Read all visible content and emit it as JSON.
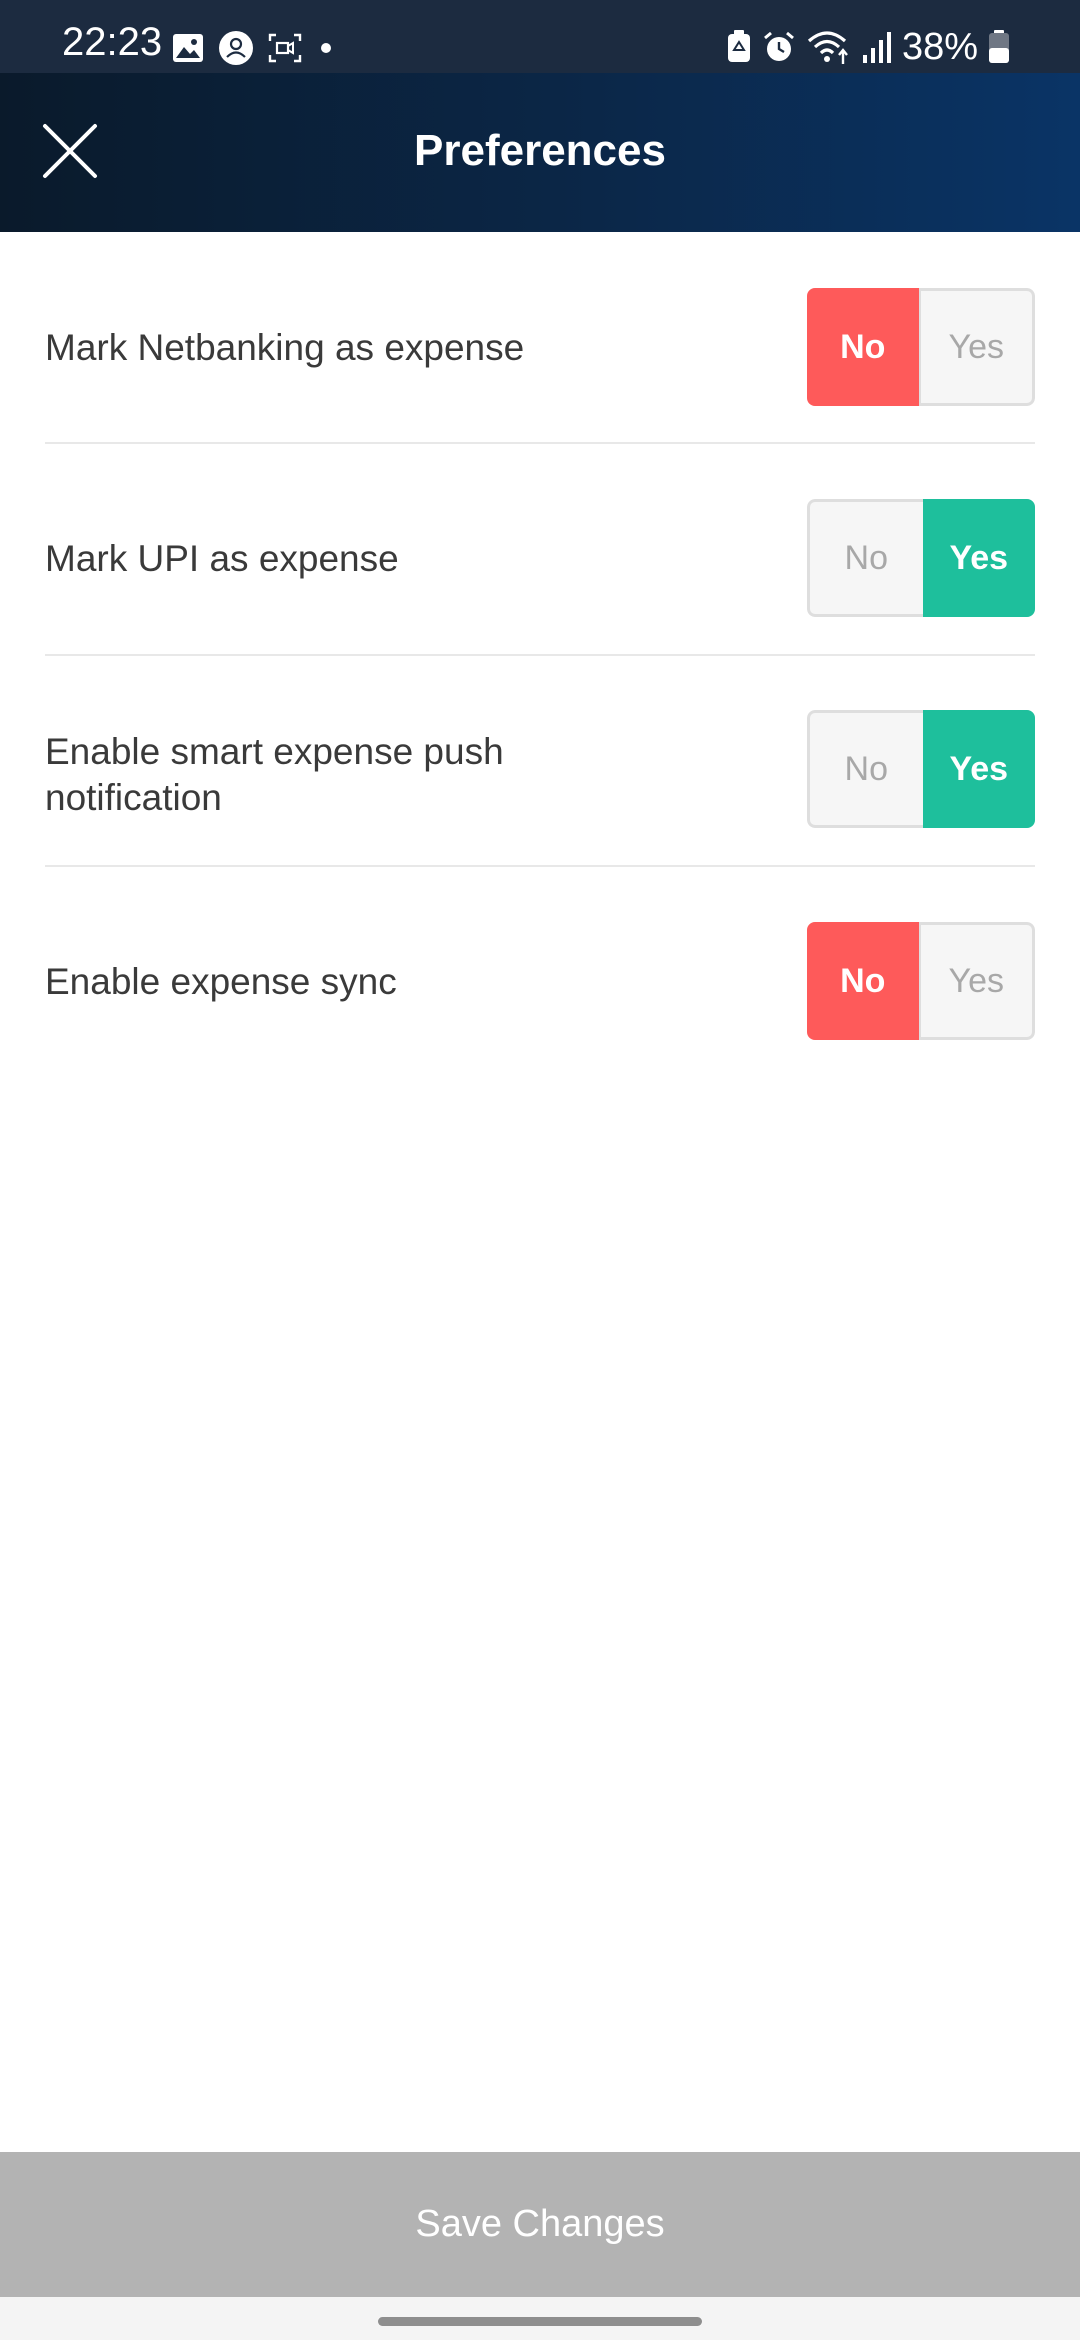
{
  "status_bar": {
    "time": "22:23",
    "battery": "38%",
    "left_icons": [
      "gallery-icon",
      "account-icon",
      "screen-capture-icon",
      "dot-icon"
    ],
    "right_icons": [
      "battery-saver-icon",
      "alarm-icon",
      "wifi-icon",
      "signal-icon",
      "battery-icon"
    ]
  },
  "header": {
    "title": "Preferences",
    "close_icon": "close-icon"
  },
  "preferences": [
    {
      "label": "Mark Netbanking as expense",
      "no": "No",
      "yes": "Yes",
      "selected": "No"
    },
    {
      "label": "Mark UPI as expense",
      "no": "No",
      "yes": "Yes",
      "selected": "Yes"
    },
    {
      "label": "Enable smart expense push notification",
      "no": "No",
      "yes": "Yes",
      "selected": "Yes"
    },
    {
      "label": "Enable expense sync",
      "no": "No",
      "yes": "Yes",
      "selected": "No"
    }
  ],
  "save_button": {
    "label": "Save Changes"
  },
  "colors": {
    "no_active": "#fe5a5a",
    "yes_active": "#1ebf9c",
    "save_disabled": "#b3b3b3",
    "header_start": "#0a1a2b",
    "header_end": "#0a3466"
  }
}
